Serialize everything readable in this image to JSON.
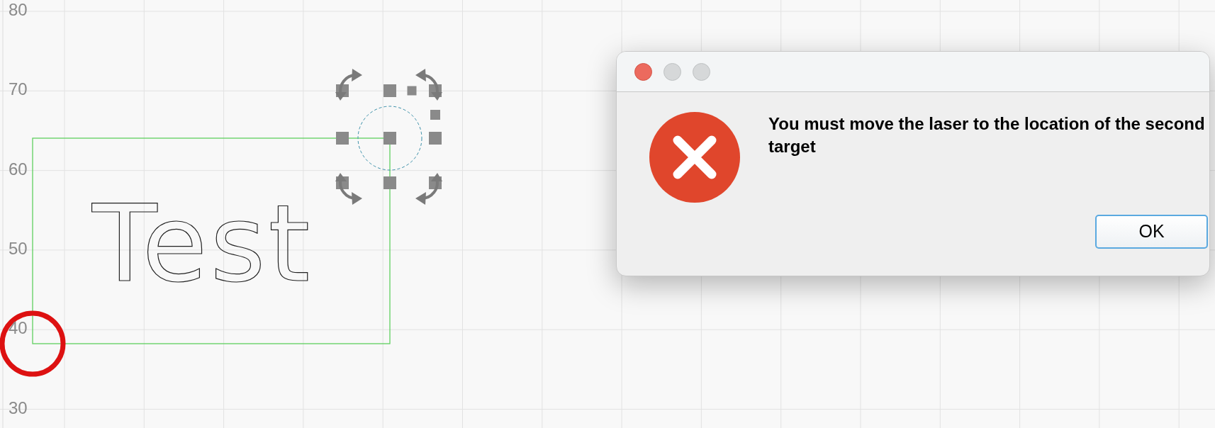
{
  "canvas": {
    "y_axis_labels": [
      "80",
      "70",
      "60",
      "50",
      "40",
      "30"
    ],
    "text_object": "Test"
  },
  "dialog": {
    "message": "You must move the laser to the location of the second target",
    "buttons": [
      "OK"
    ]
  }
}
